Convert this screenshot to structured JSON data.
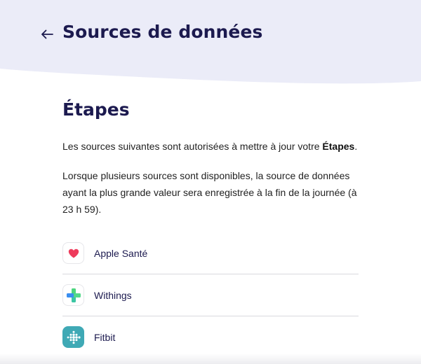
{
  "header": {
    "title": "Sources de données",
    "back_icon": "arrow-left-icon",
    "background_color": "#ebecf8"
  },
  "main": {
    "section_title": "Étapes",
    "intro_text_before": "Les sources suivantes sont autorisées à mettre à jour votre ",
    "intro_text_bold": "Étapes",
    "intro_text_after": ".",
    "description": "Lorsque plusieurs sources sont disponibles, la source de données ayant la plus grande valeur sera enregistrée à la fin de la journée (à 23 h 59)."
  },
  "sources": [
    {
      "label": "Apple Santé",
      "icon": "heart-icon"
    },
    {
      "label": "Withings",
      "icon": "plus-icon"
    },
    {
      "label": "Fitbit",
      "icon": "fitbit-dots-icon"
    }
  ],
  "colors": {
    "title": "#1c1a4f",
    "heart": "#ee3b5c",
    "fitbit_tile": "#3fa9b5"
  }
}
